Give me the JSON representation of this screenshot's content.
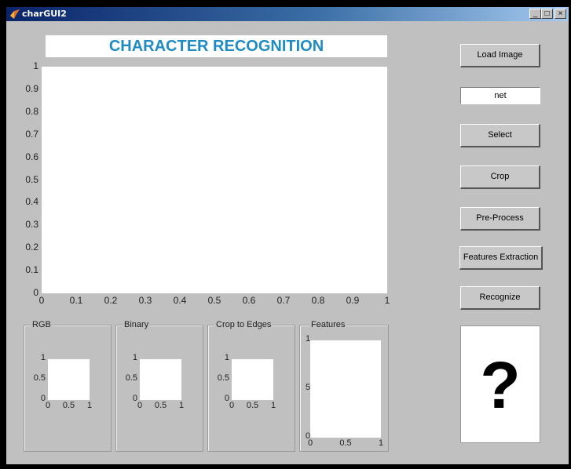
{
  "window": {
    "title": "charGUI2",
    "minimize_glyph": "_",
    "maximize_glyph": "□",
    "close_glyph": "×"
  },
  "banner": {
    "text": "CHARACTER RECOGNITION"
  },
  "main_axes": {
    "xticks": [
      "0",
      "0.1",
      "0.2",
      "0.3",
      "0.4",
      "0.5",
      "0.6",
      "0.7",
      "0.8",
      "0.9",
      "1"
    ],
    "yticks": [
      "0",
      "0.1",
      "0.2",
      "0.3",
      "0.4",
      "0.5",
      "0.6",
      "0.7",
      "0.8",
      "0.9",
      "1"
    ]
  },
  "buttons": {
    "load_image": "Load Image",
    "net_field": "net",
    "select": "Select",
    "crop": "Crop",
    "pre_process": "Pre-Process",
    "features_extraction": "Features Extraction",
    "recognize": "Recognize"
  },
  "panels": {
    "rgb": "RGB",
    "binary": "Binary",
    "crop_edges": "Crop to Edges",
    "features": "Features"
  },
  "small_axes": {
    "yticks": [
      "0",
      "0.5",
      "1"
    ],
    "xticks": [
      "0",
      "0.5",
      "1"
    ]
  },
  "features_axes": {
    "yticks": [
      "0",
      "5",
      "1"
    ],
    "xticks": [
      "0",
      "0.5",
      "1"
    ]
  },
  "result": {
    "char": "?"
  }
}
